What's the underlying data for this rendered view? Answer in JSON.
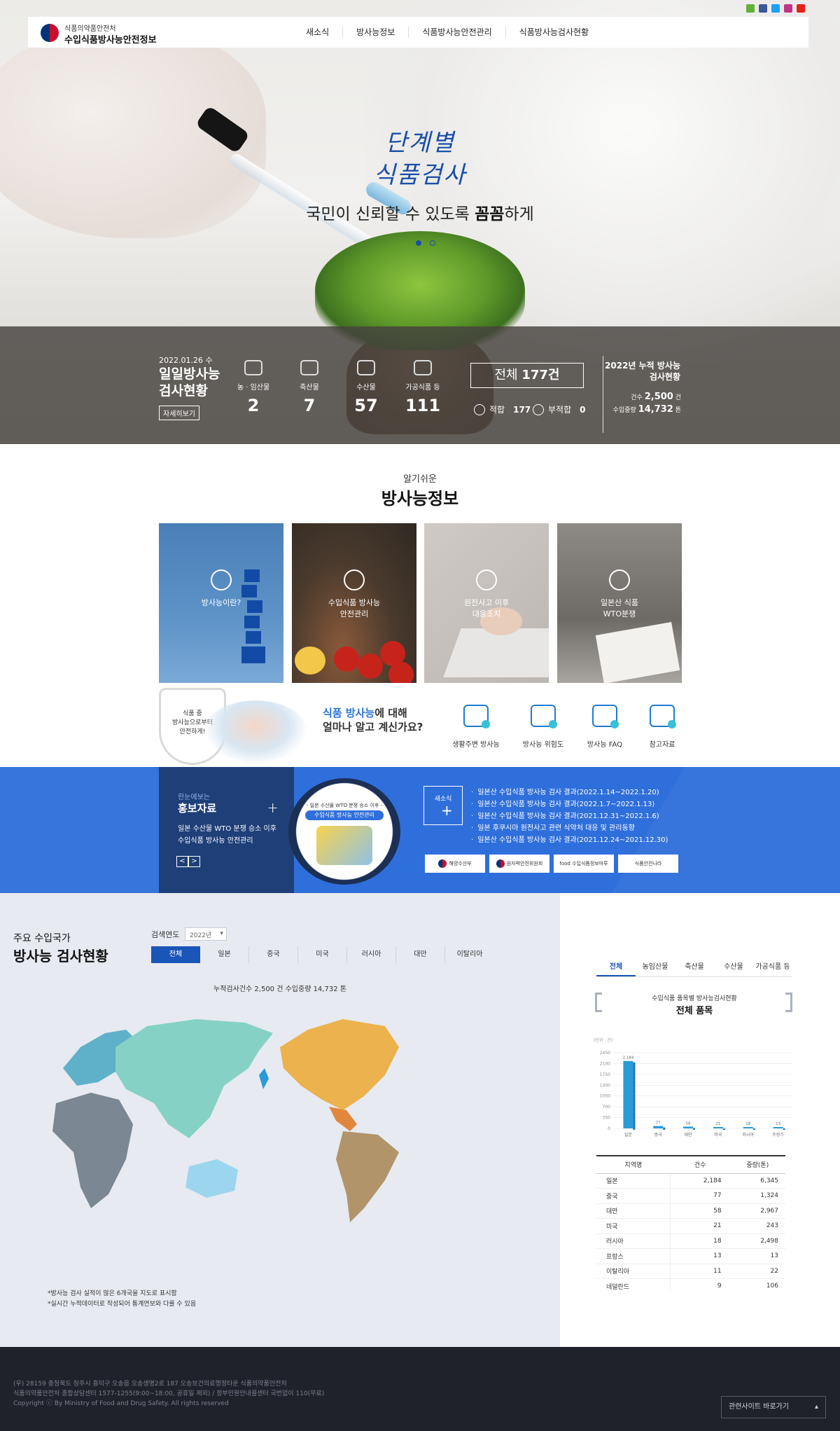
{
  "header": {
    "logo_sub": "식품의약품안전처",
    "logo_main": "수입식품방사능안전정보",
    "nav": [
      "새소식",
      "방사능정보",
      "식품방사능안전관리",
      "식품방사능검사현황"
    ],
    "sns_icons": [
      "blog-icon",
      "facebook-icon",
      "twitter-icon",
      "instagram-icon",
      "youtube-icon"
    ]
  },
  "hero": {
    "title_line1": "단계별",
    "title_line2": "식품검사",
    "slogan_pre": "국민이 신뢰할 수 있도록 ",
    "slogan_bold": "꼼꼼",
    "slogan_post": "하게",
    "slides": 2,
    "active_slide": 1
  },
  "daily": {
    "date": "2022.01.26 수",
    "title": "일일방사능 검사현황",
    "more_label": "자세히보기",
    "categories": [
      {
        "icon": "wheat-icon",
        "label": "농 · 임산물",
        "value": "2"
      },
      {
        "icon": "cow-icon",
        "label": "축산물",
        "value": "7"
      },
      {
        "icon": "fish-icon",
        "label": "수산물",
        "value": "57"
      },
      {
        "icon": "jar-icon",
        "label": "가공식품 등",
        "value": "111"
      }
    ],
    "total_label": "전체",
    "total_value": "177건",
    "pass_label": "적합",
    "pass_value": "177",
    "fail_label": "부적합",
    "fail_value": "0"
  },
  "cumulative": {
    "title": "2022년 누적 방사능 검사현황",
    "count_label": "건수",
    "count_value": "2,500",
    "count_unit": "건",
    "weight_label": "수입중량",
    "weight_value": "14,732",
    "weight_unit": "톤"
  },
  "info": {
    "subtitle": "알기쉬운",
    "title": "방사능정보",
    "cards": [
      {
        "icon": "radiation-icon",
        "label": "방사능이란?"
      },
      {
        "icon": "food-safety-icon",
        "label": "수입식품 방사능\n안전관리"
      },
      {
        "icon": "accident-icon",
        "label": "원전사고 이후\n대응조치"
      },
      {
        "icon": "wto-icon",
        "label": "일본산 식품\nWTO분쟁"
      }
    ]
  },
  "quiz": {
    "shield_text": "식품 중\n방사능으로부터\n안전하게!",
    "question_hl": "식품 방사능",
    "question_rest1": "에 대해",
    "question_line2": "얼마나 알고 계신가요?",
    "items": [
      {
        "icon": "person-radiation-icon",
        "label": "생활주변 방사능"
      },
      {
        "icon": "warning-icon",
        "label": "방사능 위험도"
      },
      {
        "icon": "chat-icon",
        "label": "방사능 FAQ"
      },
      {
        "icon": "monitor-icon",
        "label": "참고자료"
      }
    ]
  },
  "promo": {
    "sub": "한눈에보는",
    "title": "홍보자료",
    "desc": "일본 수산물 WTO 분쟁 승소 이후\n수입식품 방사능 안전관리",
    "prev": "<",
    "next": ">",
    "poster_line1": "- 일본 수산물 WTO 분쟁 승소 이후 -",
    "poster_line2": "수입식품 방사능 안전관리"
  },
  "news": {
    "label": "새소식",
    "items": [
      "일본산 수입식품 방사능 검사 결과(2022.1.14~2022.1.20)",
      "일본산 수입식품 방사능 검사 결과(2022.1.7~2022.1.13)",
      "일본산 수입식품 방사능 검사 결과(2021.12.31~2022.1.6)",
      "일본 후쿠시마 원전사고 관련 식약처 대응 및 관리동향",
      "일본산 수입식품 방사능 검사 결과(2021.12.24~2021.12.30)"
    ],
    "orgs": [
      "해양수산부",
      "원자력안전위원회",
      "food 수입식품정보마루",
      "식품안전나라"
    ]
  },
  "countries": {
    "sub": "주요 수입국가",
    "title": "방사능 검사현황",
    "year_label": "검색연도",
    "year_value": "2022년",
    "tabs": [
      "전체",
      "일본",
      "중국",
      "미국",
      "러시아",
      "대만",
      "이탈리아"
    ],
    "active_tab": 0,
    "cumulative_line": "누적검사건수 2,500 건    수입중량 14,732 톤",
    "notes": [
      "*방사능 검사 실적이 많은 6개국을 지도로 표시함",
      "*실시간 누적데이터로 작성되어 통계연보와 다를 수 있음"
    ],
    "map_colors": {
      "europe": "#5fb1c9",
      "asia": "#86d1c6",
      "africa": "#7b8792",
      "north_america": "#ebb24e",
      "south_america": "#b1946a",
      "central_america": "#e1873d",
      "australia": "#9bd6ee"
    }
  },
  "products": {
    "tabs": [
      "전체",
      "농임산물",
      "축산물",
      "수산물",
      "가공식품 등"
    ],
    "active_tab": 0,
    "subtitle": "수입식품 품목별 방사능검사현황",
    "title": "전체 품목",
    "table_headers": [
      "지역명",
      "건수",
      "중량(톤)"
    ],
    "table_rows": [
      [
        "일본",
        "2,184",
        "6,345"
      ],
      [
        "중국",
        "77",
        "1,324"
      ],
      [
        "대만",
        "58",
        "2,967"
      ],
      [
        "미국",
        "21",
        "243"
      ],
      [
        "러시아",
        "18",
        "2,498"
      ],
      [
        "프랑스",
        "13",
        "13"
      ],
      [
        "이탈리아",
        "11",
        "22"
      ],
      [
        "네덜란드",
        "9",
        "106"
      ]
    ]
  },
  "chart_data": {
    "type": "bar",
    "ylabel": "(단위 : 건)",
    "categories": [
      "일본",
      "중국",
      "대만",
      "미국",
      "러시아",
      "프랑스"
    ],
    "values": [
      2184,
      77,
      58,
      21,
      18,
      13
    ],
    "data_labels": [
      "2,184",
      "77",
      "58",
      "21",
      "18",
      "13"
    ],
    "yticks": [
      0,
      350,
      700,
      1050,
      1400,
      1750,
      2100,
      2450
    ],
    "ylim": [
      0,
      2450
    ],
    "grid": true,
    "bar_color": "#2a9bd8"
  },
  "footer": {
    "text": "(우) 28159 충청북도 청주시 흥덕구 오송읍 오송생명2로 187 오송보건의료행정타운 식품의약품안전처\n식품의약품안전처 종합상담센터 1577-1255(9:00~18:00, 공휴일 제외) / 정부민원안내콜센터 국번없이 110(무료)\nCopyright ⓒ By Ministry of Food and Drug Safety. All rights reserved",
    "related_label": "관련사이트 바로가기"
  }
}
